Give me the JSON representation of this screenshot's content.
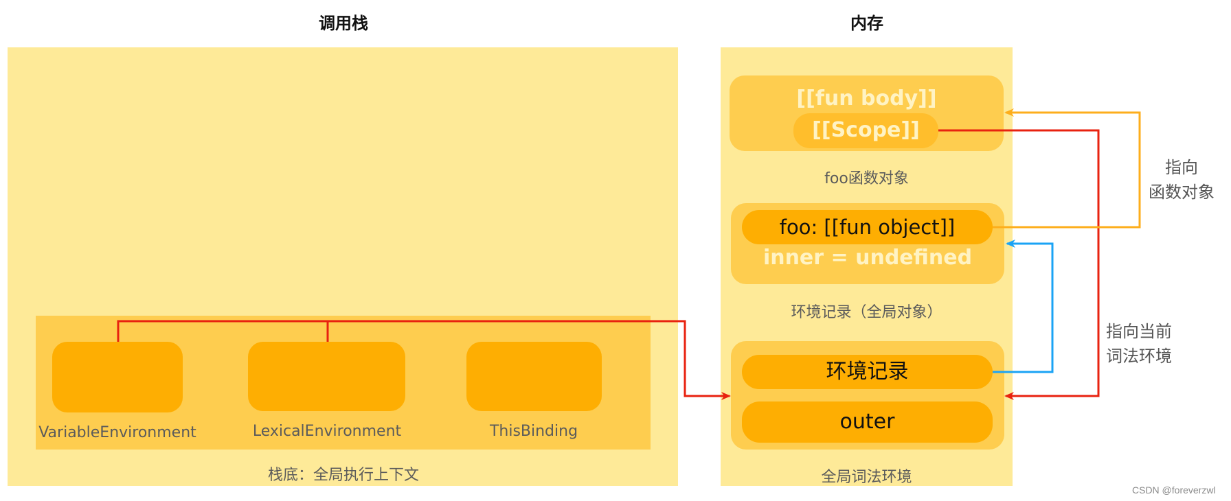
{
  "headers": {
    "call_stack": "调用栈",
    "memory": "内存"
  },
  "call_stack": {
    "context_label": "栈底：全局执行上下文",
    "slots": [
      {
        "label": "VariableEnvironment"
      },
      {
        "label": "LexicalEnvironment"
      },
      {
        "label": "ThisBinding"
      }
    ]
  },
  "memory": {
    "function_object": {
      "body": "[[fun body]]",
      "scope": "[[Scope]]",
      "caption": "foo函数对象"
    },
    "env_record": {
      "foo_entry": "foo: [[fun object]]",
      "inner_entry": "inner = undefined",
      "caption": "环境记录（全局对象）"
    },
    "lexical_env": {
      "record": "环境记录",
      "outer": "outer",
      "caption": "全局词法环境"
    }
  },
  "annotations": {
    "points_to_function": [
      "指向",
      "函数对象"
    ],
    "points_to_lexical_env": [
      "指向当前",
      "词法环境"
    ]
  },
  "colors": {
    "panel": "#feea98",
    "context": "#fecd4f",
    "slot": "#feae02",
    "red_arrow": "#e8220f",
    "orange_arrow": "#fdae1c",
    "blue_arrow": "#1aa3f5"
  },
  "watermark": "CSDN @foreverzwl"
}
